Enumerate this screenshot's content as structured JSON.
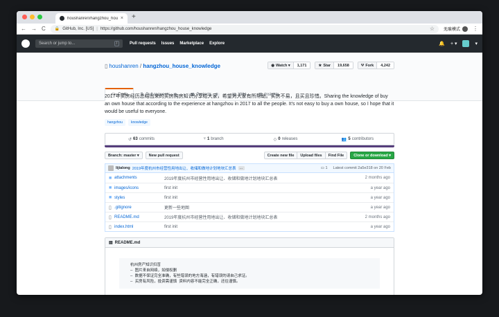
{
  "browser": {
    "tab_title": "houshanren/hangzhou_house_k",
    "tab_close": "×",
    "new_tab": "+",
    "back": "←",
    "forward": "→",
    "reload": "C",
    "site_identity": "GitHub, Inc. [US]",
    "separator": "|",
    "url": "https://github.com/houshanren/hangzhou_house_knowledge",
    "incognito_label": "无痕模式",
    "menu": "⋮",
    "colors": {
      "red": "#ff5f57",
      "yellow": "#febc2e",
      "green": "#28c840"
    }
  },
  "github": {
    "search_placeholder": "Search or jump to...",
    "search_shortcut": "/",
    "nav": [
      "Pull requests",
      "Issues",
      "Marketplace",
      "Explore"
    ],
    "bell": "🔔",
    "plus": "+ ▾",
    "avatar_caret": "▾"
  },
  "repo": {
    "owner": "houshanren",
    "slash": "/",
    "name": "hangzhou_house_knowledge",
    "watch_label": "Watch ▾",
    "watch_count": "1,171",
    "star_label": "Star",
    "star_count": "19,658",
    "fork_label": "Fork",
    "fork_count": "4,242",
    "tabs": [
      {
        "label": "Code",
        "icon": "<>",
        "count": ""
      },
      {
        "label": "Pull requests",
        "icon": "⇅",
        "count": "4"
      },
      {
        "label": "Projects",
        "icon": "▦",
        "count": "0"
      },
      {
        "label": "Wiki",
        "icon": "▤",
        "count": ""
      },
      {
        "label": "Insights",
        "icon": "▥",
        "count": ""
      }
    ]
  },
  "about": {
    "description": "2017年买房经历总结出来的买房购房知识分享给大家，希望对大家有所帮助。买房不易，且买且珍惜。Sharing the knowledge of buy an own house that according to the experience at hangzhou in 2017 to all the people. It's not easy to buy a own house, so I hope that it would be useful to everyone.",
    "topics": [
      "hangzhou",
      "knowledge"
    ]
  },
  "stats": {
    "commits": {
      "count": "63",
      "label": "commits"
    },
    "branch": {
      "count": "1",
      "label": "branch"
    },
    "releases": {
      "count": "0",
      "label": "releases"
    },
    "contributors": {
      "count": "5",
      "label": "contributors"
    }
  },
  "filebar": {
    "branch": "Branch: master ▾",
    "new_pr": "New pull request",
    "create_file": "Create new file",
    "upload": "Upload files",
    "find": "Find File",
    "clone": "Clone or download ▾"
  },
  "commit": {
    "author": "lijialong",
    "message": "2019年度杭州市经营性用地出让、收储和做地计划地块汇总表",
    "more": "…",
    "comments": "1",
    "latest": "Latest commit 2a5e318 on 20 Feb"
  },
  "files": [
    {
      "name": "attachments",
      "type": "dir",
      "message": "2019年度杭州市经营性用地出让、收储和做地计划地块汇总表",
      "age": "2 months ago"
    },
    {
      "name": "images/icons",
      "type": "dir",
      "message": "first init",
      "age": "a year ago"
    },
    {
      "name": "styles",
      "type": "dir",
      "message": "first init",
      "age": "a year ago"
    },
    {
      "name": ".gitignore",
      "type": "file",
      "message": "更新一些地图",
      "age": "a year ago"
    },
    {
      "name": "README.md",
      "type": "file",
      "message": "2019年度杭州市经营性用地出让、收储和做地计划地块汇总表",
      "age": "2 months ago"
    },
    {
      "name": "index.html",
      "type": "file",
      "message": "first init",
      "age": "a year ago"
    }
  ],
  "readme": {
    "title": "README.md",
    "content": "杭州房产知识扫盲\n— 图片来自网络，如侵权删\n— 数据不保证完全准确，有些错误的地方海涵，有错误的请自己求证。\n— 买房有风险，投资需谨慎 资料内容不能完全正确，还往谨慎。"
  }
}
